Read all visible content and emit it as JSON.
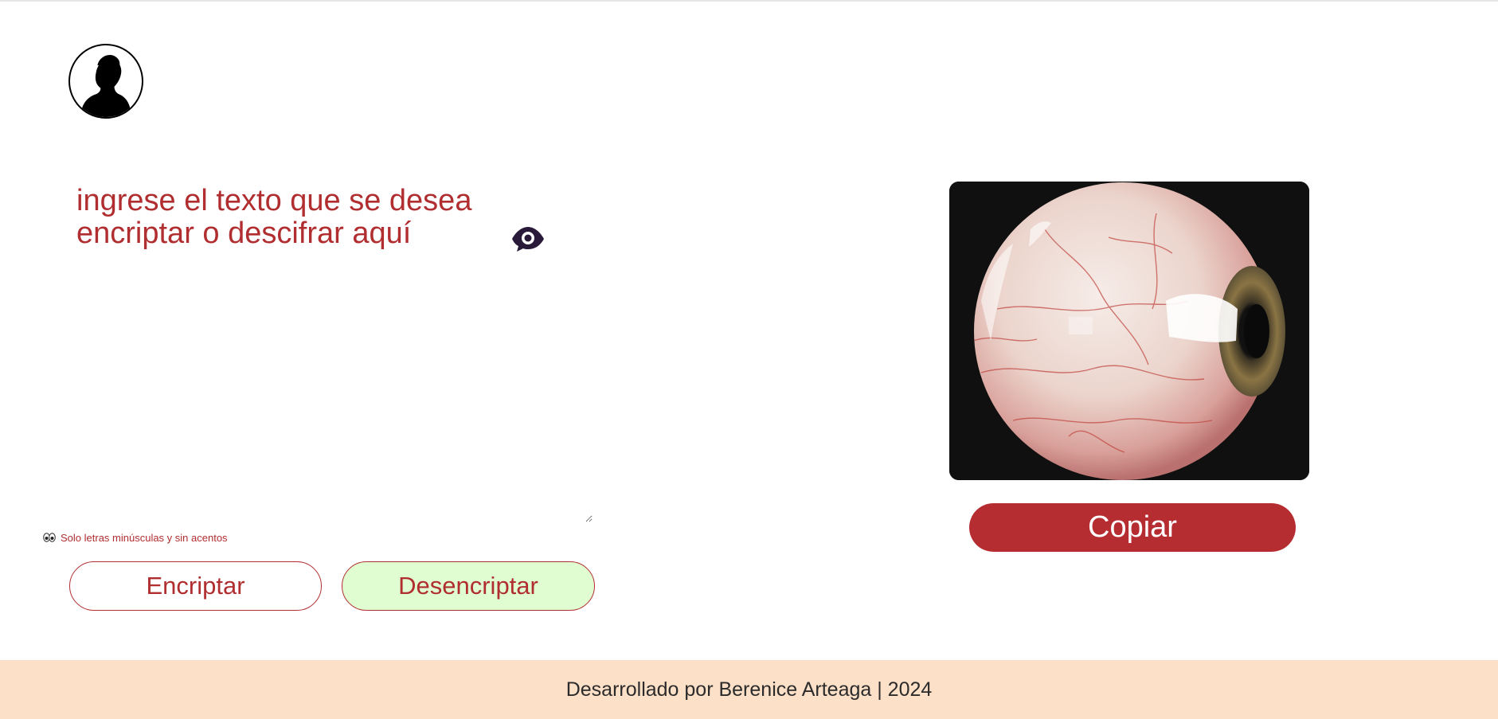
{
  "logo": {
    "icon": "silhouette-icon"
  },
  "input": {
    "placeholder": "ingrese el texto que se desea encriptar o descifrar aquí",
    "icon": "eye-icon",
    "resize_icon": "resize-handle-icon"
  },
  "hint": {
    "icon": "eyes-icon",
    "text": "Solo letras minúsculas y sin acentos"
  },
  "buttons": {
    "encrypt_label": "Encriptar",
    "decrypt_label": "Desencriptar",
    "copy_label": "Copiar"
  },
  "result": {
    "image": "eyeball-image"
  },
  "footer": {
    "text": "Desarrollado por Berenice Arteaga | 2024"
  },
  "colors": {
    "accent": "#b12e30",
    "copy_button": "#b52d31",
    "decrypt_button_bg": "#e0fdd2",
    "footer_bg": "#fde0c8",
    "image_bg": "#101010"
  }
}
